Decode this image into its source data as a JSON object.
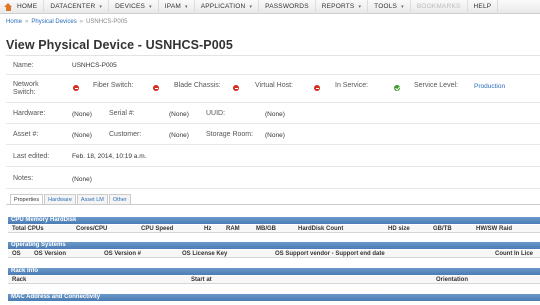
{
  "nav": {
    "home": "HOME",
    "items": [
      "DATACENTER",
      "DEVICES",
      "IPAM",
      "APPLICATION",
      "PASSWORDS",
      "REPORTS",
      "TOOLS",
      "BOOKMARKS",
      "HELP"
    ]
  },
  "breadcrumb": {
    "home": "Home",
    "section": "Physical Devices",
    "current": "USNHCS-P005"
  },
  "page_title": "View Physical Device - USNHCS-P005",
  "fields": {
    "name_label": "Name:",
    "name_value": "USNHCS-P005",
    "network_switch_label": "Network Switch:",
    "fiber_switch_label": "Fiber Switch:",
    "blade_chassis_label": "Blade Chassis:",
    "virtual_host_label": "Virtual Host:",
    "in_service_label": "In Service:",
    "service_level_label": "Service Level:",
    "service_level_value": "Production",
    "hardware_label": "Hardware:",
    "hardware_value": "(None)",
    "serial_label": "Serial #:",
    "serial_value": "(None)",
    "uuid_label": "UUID:",
    "uuid_value": "(None)",
    "asset_label": "Asset #:",
    "asset_value": "(None)",
    "customer_label": "Customer:",
    "customer_value": "(None)",
    "storage_room_label": "Storage Room:",
    "storage_room_value": "(None)",
    "last_edited_label": "Last edited:",
    "last_edited_value": "Feb. 18, 2014, 10:19 a.m.",
    "notes_label": "Notes:",
    "notes_value": "(None)"
  },
  "tabs": [
    "Properties",
    "Hardware",
    "Asset LM",
    "Other"
  ],
  "sections": {
    "cpu": {
      "title": "CPU Memory HardDisk",
      "columns": [
        "Total CPUs",
        "Cores/CPU",
        "CPU Speed",
        "Hz",
        "RAM",
        "MB/GB",
        "HardDisk Count",
        "HD size",
        "GB/TB",
        "HW/SW Raid"
      ]
    },
    "os": {
      "title": "Operating Systems",
      "columns": [
        "OS",
        "OS Version",
        "OS Version #",
        "OS License Key",
        "OS Support vendor - Support end date",
        "Count In Lice"
      ]
    },
    "rack": {
      "title": "Rack Info",
      "columns": [
        "Rack",
        "Start at",
        "Orientation"
      ]
    },
    "mac": {
      "title": "MAC Address and Connectivity"
    }
  },
  "colors": {
    "accent": "#2a6ebb",
    "section_header": "#4b7cb3",
    "status_red": "#d62b1f",
    "status_green": "#3a9c2a"
  },
  "icons": {
    "home": "home-icon",
    "no": "red-no-icon",
    "yes": "green-check-icon"
  }
}
